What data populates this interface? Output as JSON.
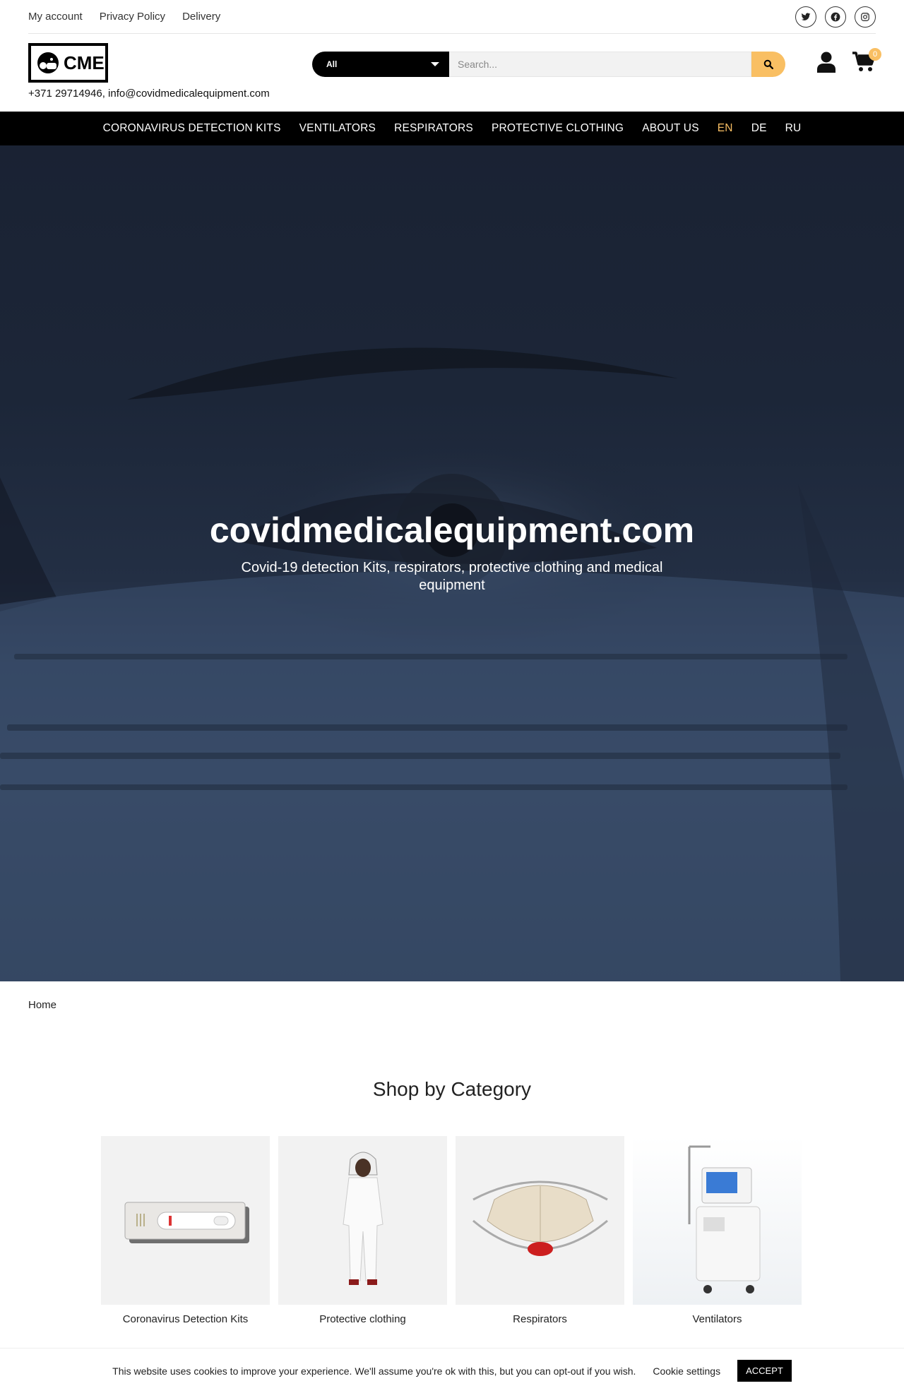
{
  "topbar": {
    "links": [
      "My account",
      "Privacy Policy",
      "Delivery"
    ],
    "social_icons": [
      "twitter-icon",
      "facebook-icon",
      "instagram-icon"
    ]
  },
  "header": {
    "logo_text": "CME",
    "contact": "+371 29714946, info@covidmedicalequipment.com",
    "search": {
      "category": "All",
      "placeholder": "Search..."
    },
    "cart_count": "0"
  },
  "nav": {
    "items": [
      "CORONAVIRUS DETECTION KITS",
      "VENTILATORS",
      "RESPIRATORS",
      "PROTECTIVE CLOTHING",
      "ABOUT US",
      "EN",
      "DE",
      "RU"
    ],
    "active": "EN"
  },
  "hero": {
    "title": "covidmedicalequipment.com",
    "subtitle": "Covid-19 detection Kits, respirators, protective clothing and medical equipment"
  },
  "breadcrumb": "Home",
  "shop": {
    "title": "Shop by Category",
    "categories": [
      "Coronavirus Detection Kits",
      "Protective clothing",
      "Respirators",
      "Ventilators"
    ]
  },
  "cookie": {
    "message": "This website uses cookies to improve your experience. We'll assume you're ok with this, but you can opt-out if you wish.",
    "settings": "Cookie settings",
    "accept": "ACCEPT"
  },
  "colors": {
    "accent": "#f9bf63",
    "nav_bg": "#000000"
  }
}
